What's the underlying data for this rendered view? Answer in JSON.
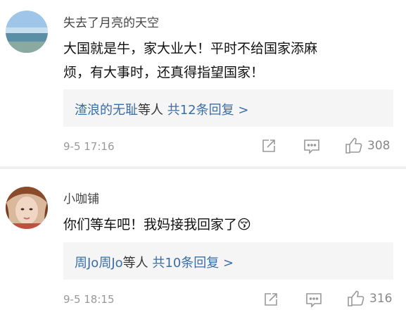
{
  "comments": [
    {
      "username": "失去了月亮的天空",
      "content_line1": "大国就是牛，家大业大！平时不给国家添麻",
      "content_line2": "烦，有大事时，还真得指望国家！",
      "reply_users": "渣浪的无耻",
      "reply_mid": "等人",
      "reply_count_text": "共12条回复 >",
      "timestamp": "9-5 17:16",
      "likes": "308"
    },
    {
      "username": "小咖铺",
      "content_line1": "你们等车吧！我妈接我回家了",
      "emoji": "😚",
      "reply_users": "周Jo周Jo",
      "reply_mid": "等人",
      "reply_count_text": "共10条回复 >",
      "timestamp": "9-5 18:15",
      "likes": "316"
    }
  ],
  "icons": {
    "share": "share-icon",
    "comment": "comment-icon",
    "like": "thumbs-up-icon"
  }
}
